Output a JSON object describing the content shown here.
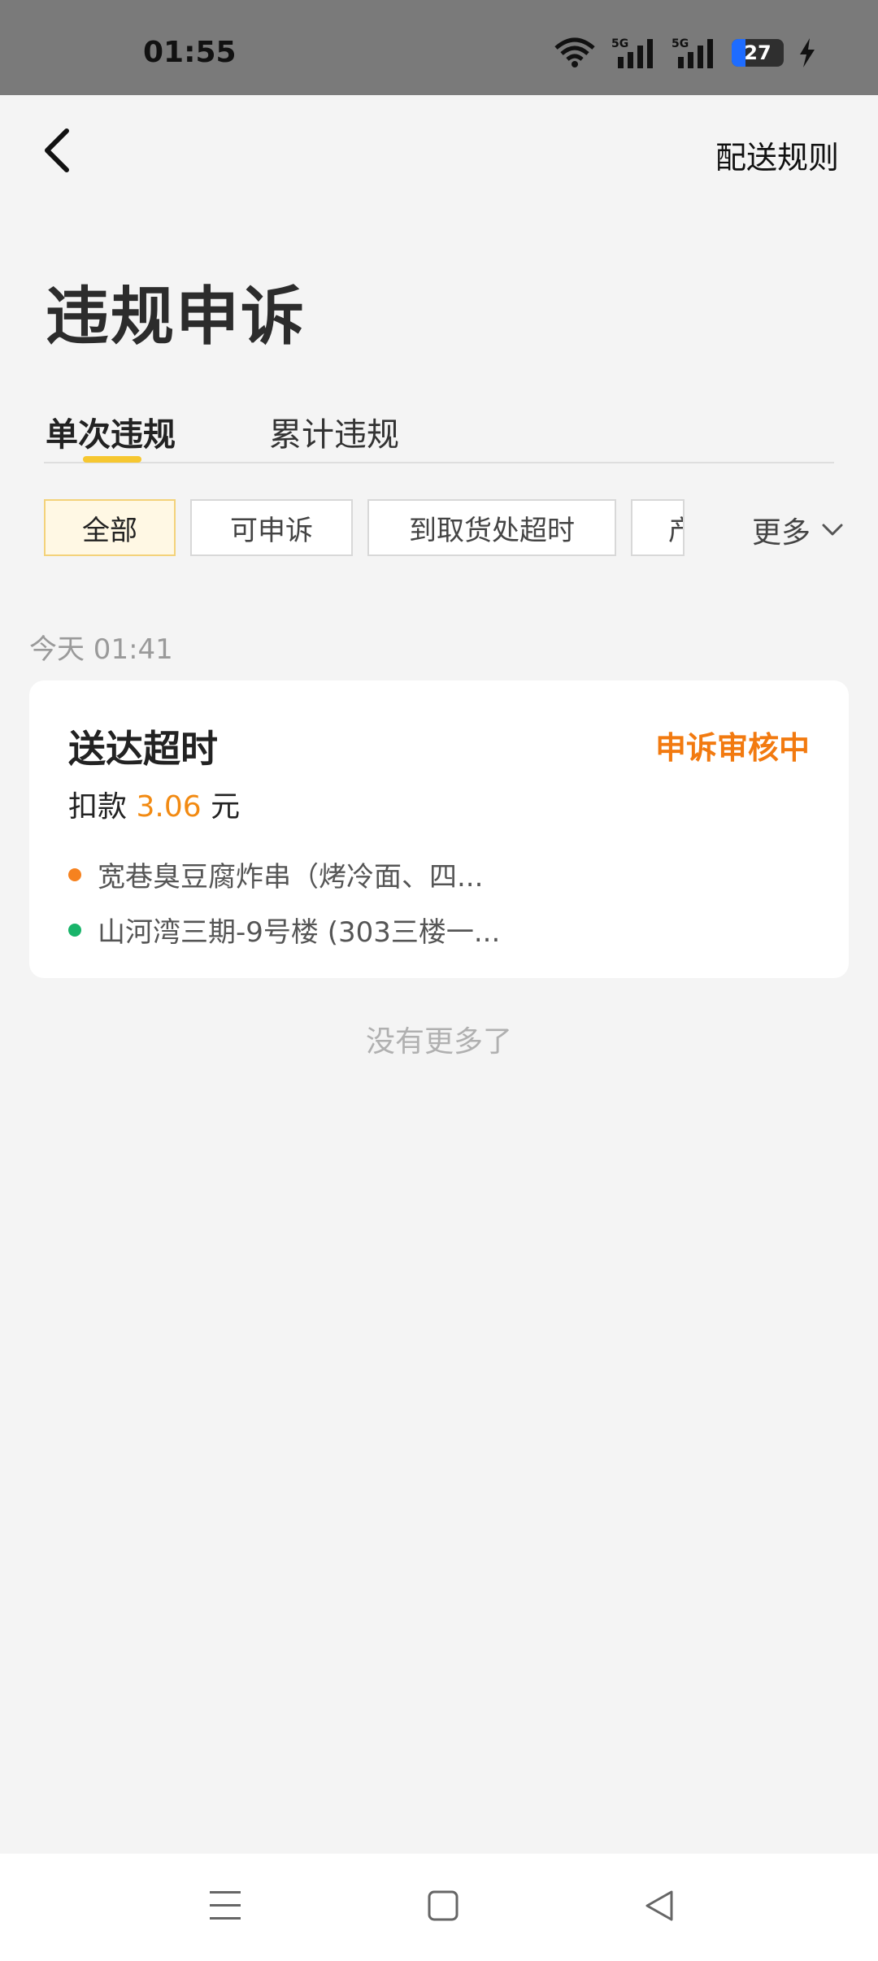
{
  "status_bar": {
    "time": "01:55",
    "battery_level": "27",
    "battery_percent": 27,
    "icons": [
      "wifi-icon",
      "signal-5g-icon",
      "signal-5g-icon",
      "battery-icon",
      "charging-icon"
    ]
  },
  "nav": {
    "back_icon": "chevron-left-icon",
    "rules_label": "配送规则"
  },
  "page": {
    "title": "违规申诉"
  },
  "tabs": [
    {
      "label": "单次违规",
      "active": true
    },
    {
      "label": "累计违规",
      "active": false
    }
  ],
  "filters": {
    "chips": [
      {
        "label": "全部",
        "active": true
      },
      {
        "label": "可申诉",
        "active": false
      },
      {
        "label": "到取货处超时",
        "active": false
      },
      {
        "label": "产",
        "active": false
      }
    ],
    "more_label": "更多"
  },
  "records": {
    "date": "今天 01:41",
    "items": [
      {
        "title": "送达超时",
        "status": "申诉审核中",
        "deduct_prefix": "扣款",
        "deduct_amount": "3.06",
        "deduct_unit": "元",
        "pickup": "宽巷臭豆腐炸串（烤冷面、四...",
        "dropoff": "山河湾三期-9号楼 (303三楼一..."
      }
    ]
  },
  "footer": {
    "no_more": "没有更多了"
  },
  "colors": {
    "accent": "#f6c730",
    "status_orange": "#f27a10",
    "amount_orange": "#f28a12",
    "pickup_dot": "#f6821f",
    "dropoff_dot": "#19b46a"
  },
  "system_nav": {
    "icons": [
      "menu-icon",
      "home-icon",
      "back-triangle-icon"
    ]
  }
}
